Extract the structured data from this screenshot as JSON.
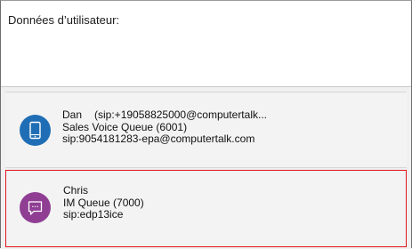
{
  "header": {
    "title": "Données d’utilisateur:"
  },
  "contacts": [
    {
      "name": "Dan",
      "address": "(sip:+19058825000@computertalk...",
      "queue": "Sales Voice Queue (6001)",
      "sip": "sip:9054181283-epa@computertalk.com",
      "icon": "phone-icon",
      "color": "#1f6eb5"
    },
    {
      "name": "Chris",
      "queue": "IM Queue (7000)",
      "sip": "sip:edp13ice",
      "icon": "chat-bubble-icon",
      "color": "#8f3e93",
      "selected": true
    }
  ]
}
